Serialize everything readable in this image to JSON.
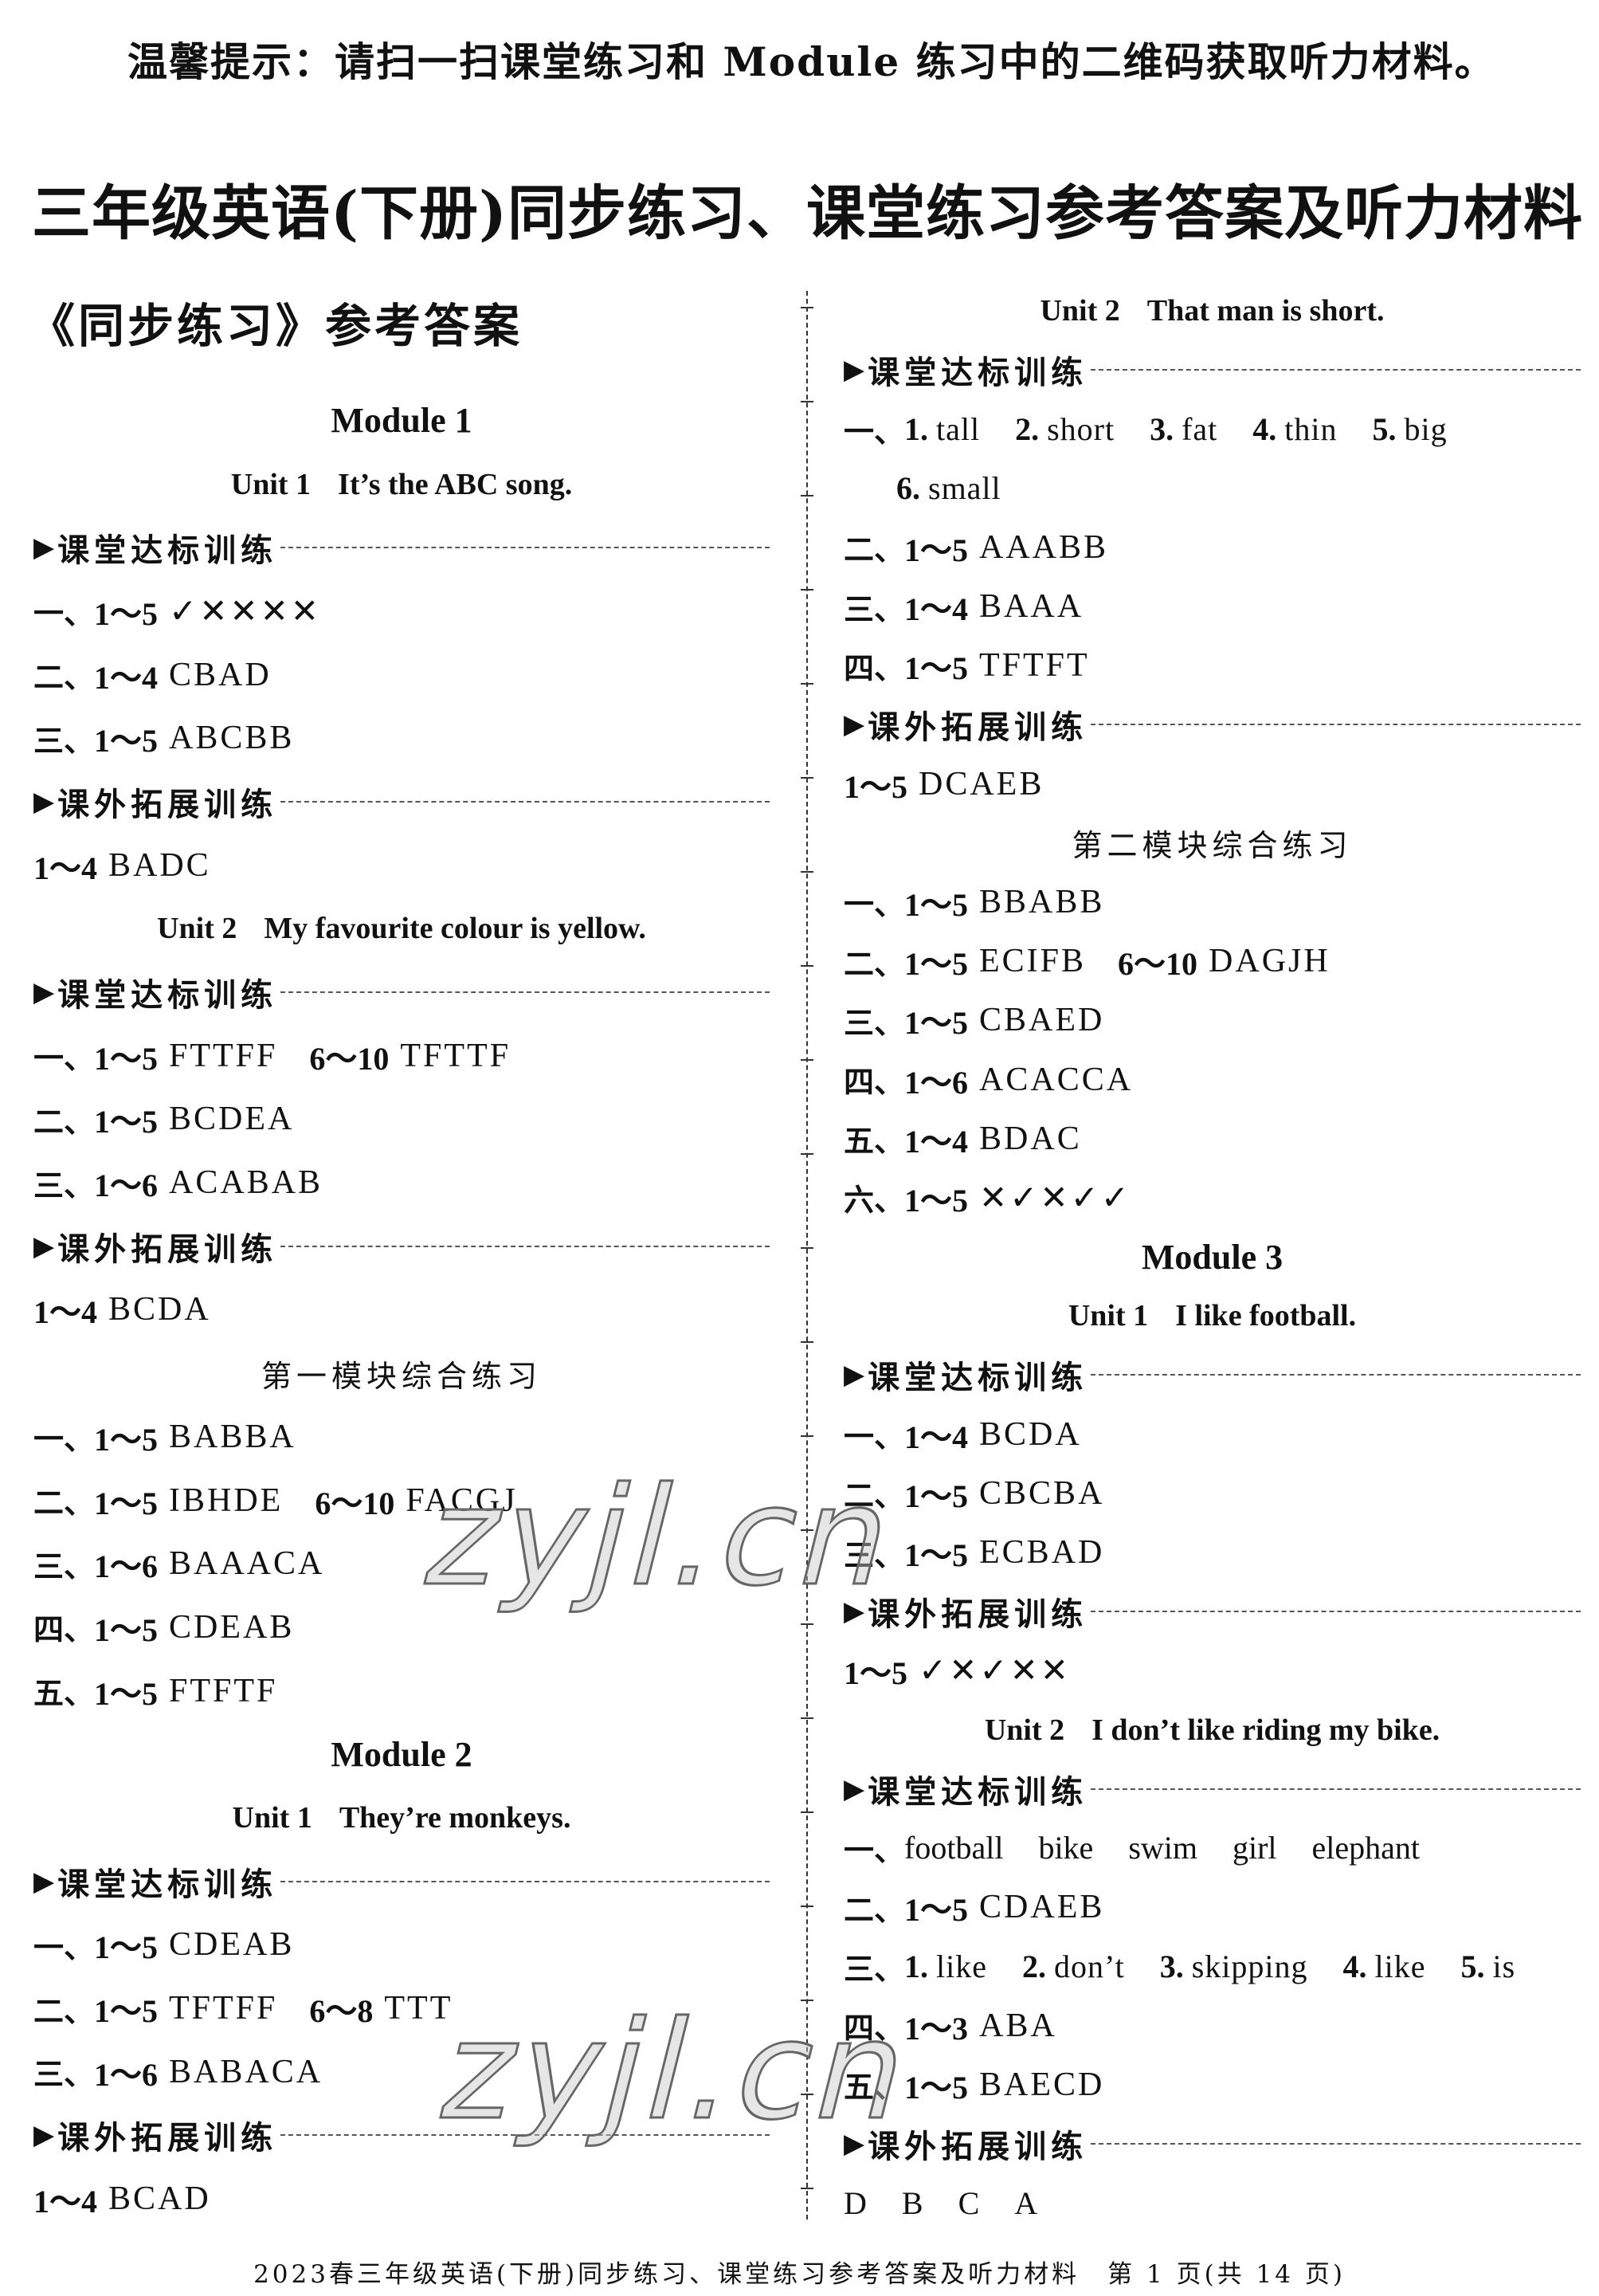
{
  "notice": "温馨提示：请扫一扫课堂练习和 Module 练习中的二维码获取听力材料。",
  "title": "三年级英语(下册)同步练习、课堂练习参考答案及听力材料",
  "section_title": "《同步练习》参考答案",
  "watermark": "zyjl.cn",
  "footer": "2023春三年级英语(下册)同步练习、课堂练习参考答案及听力材料　第 1 页(共 14 页)",
  "left": [
    {
      "type": "module",
      "text": "Module 1"
    },
    {
      "type": "unit",
      "unit": "Unit 1",
      "text": "It’s the ABC song."
    },
    {
      "type": "section",
      "text": "课堂达标训练"
    },
    {
      "type": "answer",
      "prefix": "一、",
      "range": "1～5",
      "answer": "✓✕✕✕✕"
    },
    {
      "type": "answer",
      "prefix": "二、",
      "range": "1～4",
      "answer": "CBAD"
    },
    {
      "type": "answer",
      "prefix": "三、",
      "range": "1～5",
      "answer": "ABCBB"
    },
    {
      "type": "section",
      "text": "课外拓展训练"
    },
    {
      "type": "answer",
      "prefix": "",
      "range": "1～4",
      "answer": "BADC"
    },
    {
      "type": "unit",
      "unit": "Unit 2",
      "text": "My favourite colour is yellow."
    },
    {
      "type": "section",
      "text": "课堂达标训练"
    },
    {
      "type": "answer",
      "prefix": "一、",
      "range": "1～5",
      "answer": "FTTFF",
      "range2": "6～10",
      "answer2": "TFTTF"
    },
    {
      "type": "answer",
      "prefix": "二、",
      "range": "1～5",
      "answer": "BCDEA"
    },
    {
      "type": "answer",
      "prefix": "三、",
      "range": "1～6",
      "answer": "ACABAB"
    },
    {
      "type": "section",
      "text": "课外拓展训练"
    },
    {
      "type": "answer",
      "prefix": "",
      "range": "1～4",
      "answer": "BCDA"
    },
    {
      "type": "cnhead",
      "text": "第一模块综合练习"
    },
    {
      "type": "answer",
      "prefix": "一、",
      "range": "1～5",
      "answer": "BABBA"
    },
    {
      "type": "answer",
      "prefix": "二、",
      "range": "1～5",
      "answer": "IBHDE",
      "range2": "6～10",
      "answer2": "FACGJ"
    },
    {
      "type": "answer",
      "prefix": "三、",
      "range": "1～6",
      "answer": "BAAACA"
    },
    {
      "type": "answer",
      "prefix": "四、",
      "range": "1～5",
      "answer": "CDEAB"
    },
    {
      "type": "answer",
      "prefix": "五、",
      "range": "1～5",
      "answer": "FTFTF"
    },
    {
      "type": "module",
      "text": "Module 2"
    },
    {
      "type": "unit",
      "unit": "Unit 1",
      "text": "They’re monkeys."
    },
    {
      "type": "section",
      "text": "课堂达标训练"
    },
    {
      "type": "answer",
      "prefix": "一、",
      "range": "1～5",
      "answer": "CDEAB"
    },
    {
      "type": "answer",
      "prefix": "二、",
      "range": "1～5",
      "answer": "TFTFF",
      "range2": "6～8",
      "answer2": "TTT"
    },
    {
      "type": "answer",
      "prefix": "三、",
      "range": "1～6",
      "answer": "BABACA"
    },
    {
      "type": "section",
      "text": "课外拓展训练"
    },
    {
      "type": "answer",
      "prefix": "",
      "range": "1～4",
      "answer": "BCAD"
    }
  ],
  "right": [
    {
      "type": "unit",
      "unit": "Unit 2",
      "text": "That man is short."
    },
    {
      "type": "section",
      "text": "课堂达标训练"
    },
    {
      "type": "items",
      "prefix": "一、",
      "items": [
        {
          "n": "1.",
          "t": "tall"
        },
        {
          "n": "2.",
          "t": "short"
        },
        {
          "n": "3.",
          "t": "fat"
        },
        {
          "n": "4.",
          "t": "thin"
        },
        {
          "n": "5.",
          "t": "big"
        }
      ]
    },
    {
      "type": "items",
      "prefix": "",
      "indent": true,
      "items": [
        {
          "n": "6.",
          "t": "small"
        }
      ]
    },
    {
      "type": "answer",
      "prefix": "二、",
      "range": "1～5",
      "answer": "AAABB"
    },
    {
      "type": "answer",
      "prefix": "三、",
      "range": "1～4",
      "answer": "BAAA"
    },
    {
      "type": "answer",
      "prefix": "四、",
      "range": "1～5",
      "answer": "TFTFT"
    },
    {
      "type": "section",
      "text": "课外拓展训练"
    },
    {
      "type": "answer",
      "prefix": "",
      "range": "1～5",
      "answer": "DCAEB"
    },
    {
      "type": "cnhead",
      "text": "第二模块综合练习"
    },
    {
      "type": "answer",
      "prefix": "一、",
      "range": "1～5",
      "answer": "BBABB"
    },
    {
      "type": "answer",
      "prefix": "二、",
      "range": "1～5",
      "answer": "ECIFB",
      "range2": "6～10",
      "answer2": "DAGJH"
    },
    {
      "type": "answer",
      "prefix": "三、",
      "range": "1～5",
      "answer": "CBAED"
    },
    {
      "type": "answer",
      "prefix": "四、",
      "range": "1～6",
      "answer": "ACACCA"
    },
    {
      "type": "answer",
      "prefix": "五、",
      "range": "1～4",
      "answer": "BDAC"
    },
    {
      "type": "answer",
      "prefix": "六、",
      "range": "1～5",
      "answer": "✕✓✕✓✓"
    },
    {
      "type": "module",
      "text": "Module 3"
    },
    {
      "type": "unit",
      "unit": "Unit 1",
      "text": "I like football."
    },
    {
      "type": "section",
      "text": "课堂达标训练"
    },
    {
      "type": "answer",
      "prefix": "一、",
      "range": "1～4",
      "answer": "BCDA"
    },
    {
      "type": "answer",
      "prefix": "二、",
      "range": "1～5",
      "answer": "CBCBA"
    },
    {
      "type": "answer",
      "prefix": "三、",
      "range": "1～5",
      "answer": "ECBAD"
    },
    {
      "type": "section",
      "text": "课外拓展训练"
    },
    {
      "type": "answer",
      "prefix": "",
      "range": "1～5",
      "answer": "✓✕✓✕✕"
    },
    {
      "type": "unit",
      "unit": "Unit 2",
      "text": "I don’t like riding my bike."
    },
    {
      "type": "section",
      "text": "课堂达标训练"
    },
    {
      "type": "words",
      "prefix": "一、",
      "words": [
        "football",
        "bike",
        "swim",
        "girl",
        "elephant"
      ]
    },
    {
      "type": "answer",
      "prefix": "二、",
      "range": "1～5",
      "answer": "CDAEB"
    },
    {
      "type": "items",
      "prefix": "三、",
      "items": [
        {
          "n": "1.",
          "t": "like"
        },
        {
          "n": "2.",
          "t": "don’t"
        },
        {
          "n": "3.",
          "t": "skipping"
        },
        {
          "n": "4.",
          "t": "like"
        },
        {
          "n": "5.",
          "t": "is"
        }
      ]
    },
    {
      "type": "answer",
      "prefix": "四、",
      "range": "1～3",
      "answer": "ABA"
    },
    {
      "type": "answer",
      "prefix": "五、 ",
      "range": "1～5",
      "answer": "BAECD"
    },
    {
      "type": "section",
      "text": "课外拓展训练"
    },
    {
      "type": "words",
      "prefix": "",
      "words": [
        "D",
        "B",
        "C",
        "A"
      ]
    }
  ]
}
